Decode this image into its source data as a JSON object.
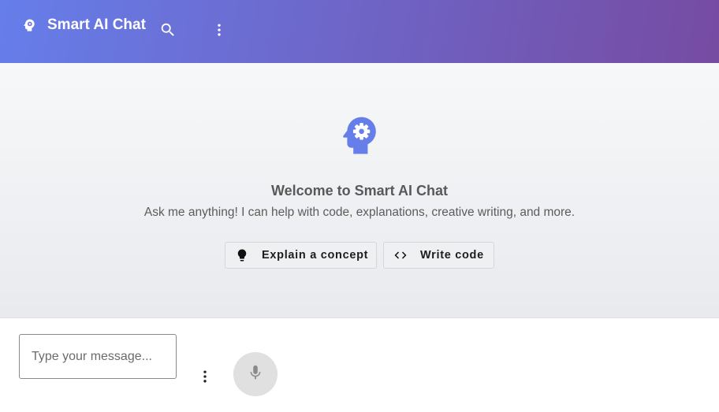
{
  "header": {
    "title": "Smart AI Chat",
    "logo_icon": "psychology-icon",
    "search_icon": "search-icon",
    "menu_icon": "more-vert-icon"
  },
  "welcome": {
    "icon": "psychology-icon",
    "title": "Welcome to Smart AI Chat",
    "subtitle": "Ask me anything! I can help with code, explanations, creative writing, and more."
  },
  "suggestions": [
    {
      "label": "Explain a concept",
      "icon": "lightbulb-icon"
    },
    {
      "label": "Write code",
      "icon": "code-icon"
    }
  ],
  "composer": {
    "placeholder": "Type your message...",
    "value": "",
    "more_icon": "more-vert-icon",
    "mic_icon": "mic-icon"
  },
  "colors": {
    "header_gradient_start": "#667eea",
    "header_gradient_end": "#764ba2",
    "accent": "#667eea",
    "mic_button_bg": "#e0e0e0"
  }
}
